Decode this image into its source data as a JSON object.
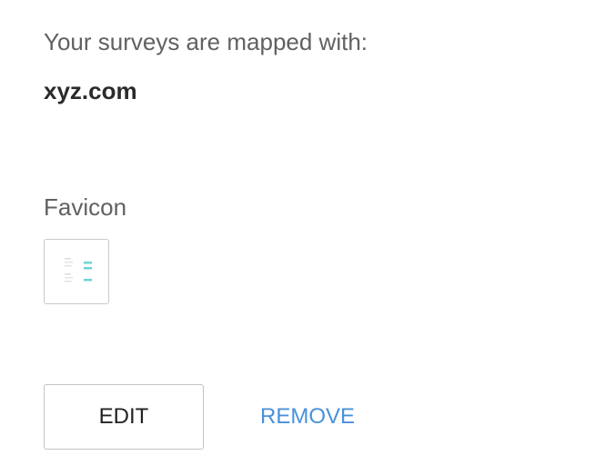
{
  "mapping": {
    "intro_text": "Your surveys are mapped with:",
    "domain": "xyz.com"
  },
  "favicon": {
    "label": "Favicon",
    "icon": "favicon-preview-icon"
  },
  "actions": {
    "edit_label": "EDIT",
    "remove_label": "REMOVE"
  },
  "colors": {
    "link": "#4a90d9",
    "text_muted": "#616161",
    "text_strong": "#2b2b2b",
    "border": "#c4c4c4",
    "favicon_accent": "#6fd3d6"
  }
}
